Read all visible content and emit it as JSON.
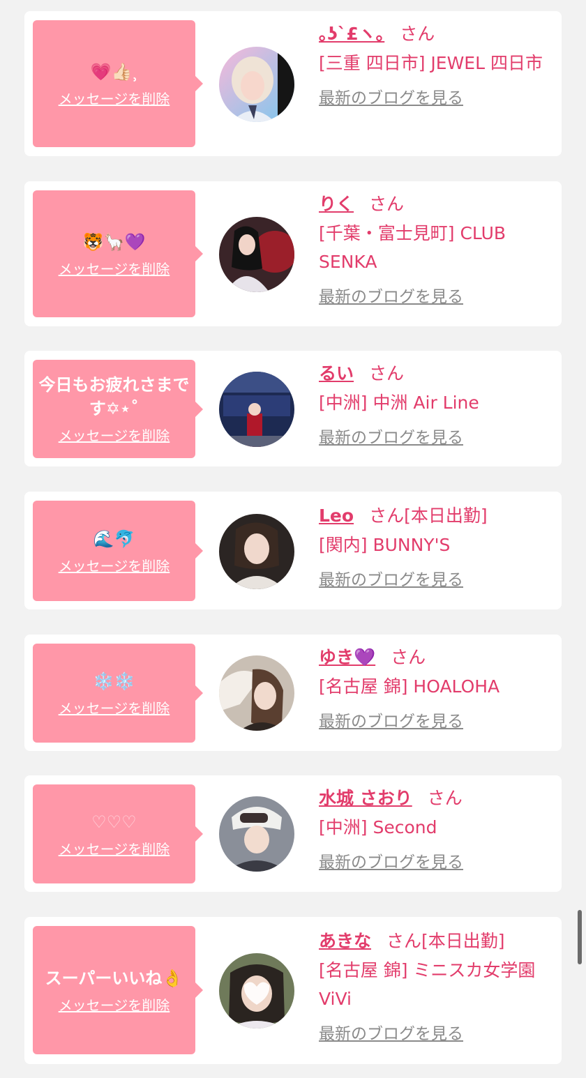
{
  "colors": {
    "accent": "#e23c6b",
    "bubble": "#ff97a8",
    "link_gray": "#8a8a8a"
  },
  "cards": [
    {
      "message": "💗👍🏻⸒",
      "delete_label": "メッセージを削除",
      "name": "｡ʖˋ£ヽ｡",
      "san": "さん",
      "shop": "[三重 四日市] JEWEL 四日市",
      "blog_label": "最新のブログを見る"
    },
    {
      "message": "🐯🦙💜",
      "delete_label": "メッセージを削除",
      "name": "りく",
      "san": "さん",
      "shop": "[千葉・富士見町] CLUB SENKA",
      "blog_label": "最新のブログを見る"
    },
    {
      "message": "今日もお疲れさまです✡⋆˚",
      "delete_label": "メッセージを削除",
      "name": "るい",
      "san": "さん",
      "shop": "[中洲] 中洲 Air Line",
      "blog_label": "最新のブログを見る"
    },
    {
      "message": "🌊🐬",
      "delete_label": "メッセージを削除",
      "name": "Leo",
      "san": "さん[本日出勤]",
      "shop": "[関内] BUNNY'S",
      "blog_label": "最新のブログを見る"
    },
    {
      "message": "❄️❄️",
      "delete_label": "メッセージを削除",
      "name": "ゆき💜",
      "san": "さん",
      "shop": "[名古屋 錦] HOALOHA",
      "blog_label": "最新のブログを見る"
    },
    {
      "message": "♡♡♡",
      "delete_label": "メッセージを削除",
      "name": "水城 さおり",
      "san": "さん",
      "shop": "[中洲] Second",
      "blog_label": "最新のブログを見る"
    },
    {
      "message": "スーパーいいね👌",
      "delete_label": "メッセージを削除",
      "name": "あきな",
      "san": "さん[本日出勤]",
      "shop": "[名古屋 錦] ミニスカ女学園ViVi",
      "blog_label": "最新のブログを見る"
    }
  ]
}
